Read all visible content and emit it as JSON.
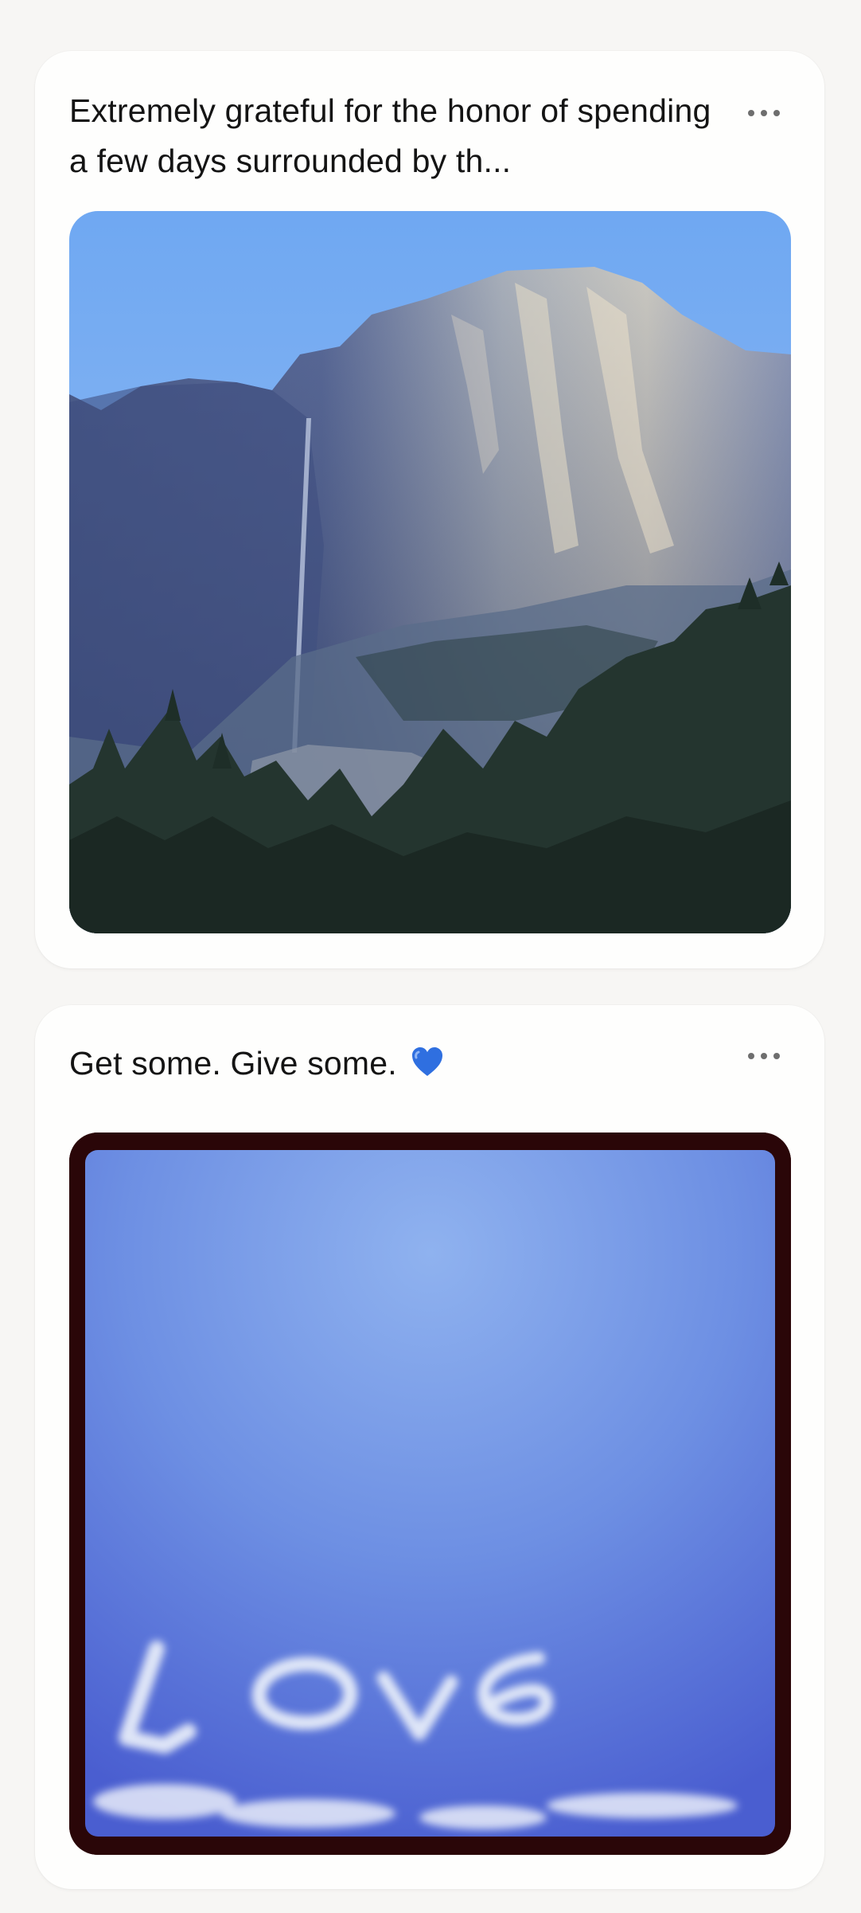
{
  "posts": [
    {
      "caption": "Extremely grateful for the honor of spending a few days surrounded by th...",
      "more_icon": "more-horizontal-icon",
      "image_subject": "granite cliff with waterfall under blue sky"
    },
    {
      "caption": "Get some. Give some.",
      "caption_emoji": "blue-heart-icon",
      "more_icon": "more-horizontal-icon",
      "image_subject": "the word love written in clouds against blue sky"
    }
  ],
  "colors": {
    "background": "#f7f6f4",
    "card": "#fefefd",
    "text": "#141414",
    "more_dots": "#6e6e6e",
    "heart": "#2f6fe0"
  }
}
